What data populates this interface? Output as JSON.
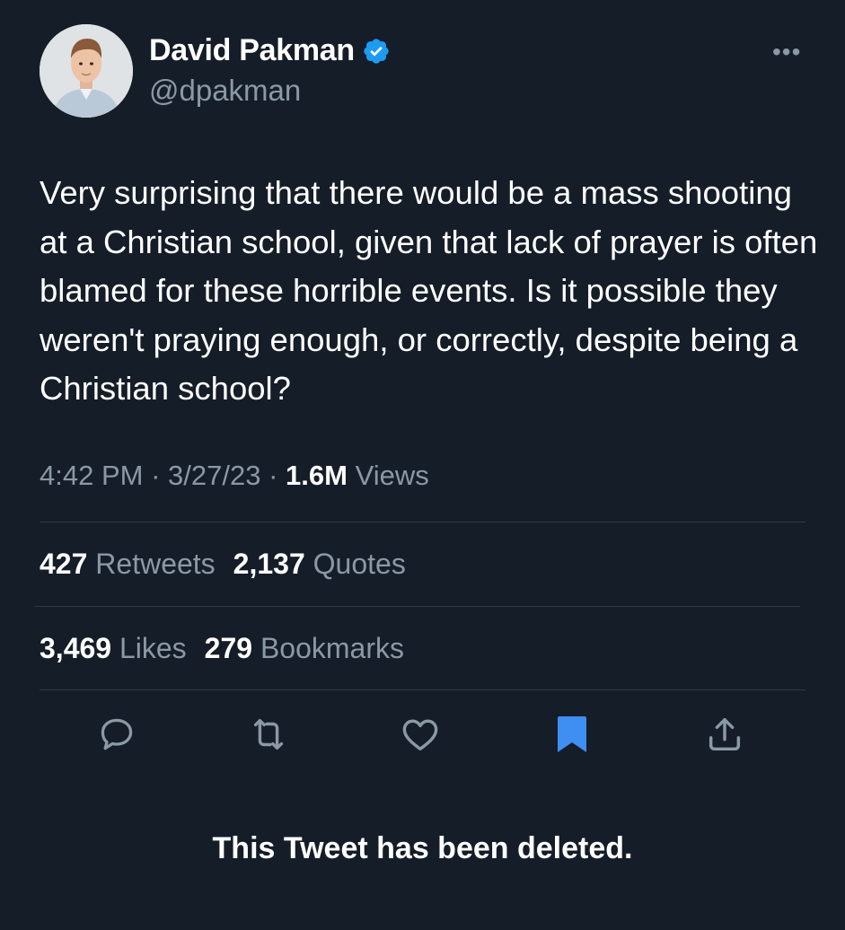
{
  "author": {
    "display_name": "David Pakman",
    "handle": "@dpakman",
    "verified_icon": "verified-badge-icon",
    "avatar": "profile-photo"
  },
  "menu": {
    "more_label": "•••"
  },
  "tweet": {
    "text": "Very surprising that there would be a mass shooting at a Christian school, given that lack of prayer is often blamed for these horrible events. Is it possible they weren't praying enough, or correctly, despite being a Christian school?",
    "time": "4:42 PM",
    "separator": "·",
    "date": "3/27/23",
    "views_count": "1.6M",
    "views_label": "Views"
  },
  "stats": {
    "retweets_count": "427",
    "retweets_label": "Retweets",
    "quotes_count": "2,137",
    "quotes_label": "Quotes",
    "likes_count": "3,469",
    "likes_label": "Likes",
    "bookmarks_count": "279",
    "bookmarks_label": "Bookmarks"
  },
  "actions": [
    "reply-icon",
    "retweet-icon",
    "like-icon",
    "bookmark-icon",
    "share-icon"
  ],
  "colors": {
    "background": "#151d28",
    "primary_text": "#ffffff",
    "secondary_text": "#8b98a5",
    "divider": "#2f3a45",
    "accent_blue": "#1d9bf0",
    "bookmark_active": "#3f8ef2"
  },
  "notice": {
    "deleted_text": "This Tweet has been deleted."
  }
}
